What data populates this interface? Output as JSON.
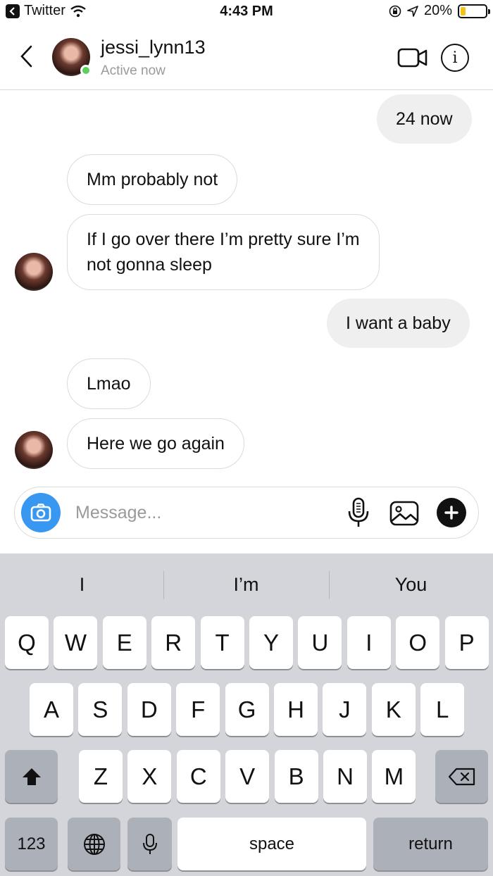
{
  "status_bar": {
    "back_app": "Twitter",
    "time": "4:43 PM",
    "battery_text": "20%",
    "battery_level": 0.2,
    "battery_color": "#f2c21a"
  },
  "header": {
    "name": "jessi_lynn13",
    "status": "Active now",
    "online_color": "#5bd15b"
  },
  "messages": [
    {
      "from": "me",
      "text": "24 now"
    },
    {
      "from": "them",
      "text": "Mm probably not"
    },
    {
      "from": "them",
      "text_lines": [
        "If I go over there I’m pretty sure I’m",
        "not gonna sleep"
      ]
    },
    {
      "from": "me",
      "text": "I want a baby"
    },
    {
      "from": "them",
      "text": "Lmao"
    },
    {
      "from": "them",
      "text": "Here we go again"
    }
  ],
  "composer": {
    "placeholder": "Message...",
    "camera_color": "#3897f0",
    "icons": [
      "camera-icon",
      "microphone-icon",
      "gallery-icon",
      "plus-icon"
    ]
  },
  "keyboard": {
    "suggestions": [
      "I",
      "I’m",
      "You"
    ],
    "row1": [
      "Q",
      "W",
      "E",
      "R",
      "T",
      "Y",
      "U",
      "I",
      "O",
      "P"
    ],
    "row2": [
      "A",
      "S",
      "D",
      "F",
      "G",
      "H",
      "J",
      "K",
      "L"
    ],
    "row3": [
      "Z",
      "X",
      "C",
      "V",
      "B",
      "N",
      "M"
    ],
    "numbers_key": "123",
    "space_key": "space",
    "return_key": "return"
  }
}
